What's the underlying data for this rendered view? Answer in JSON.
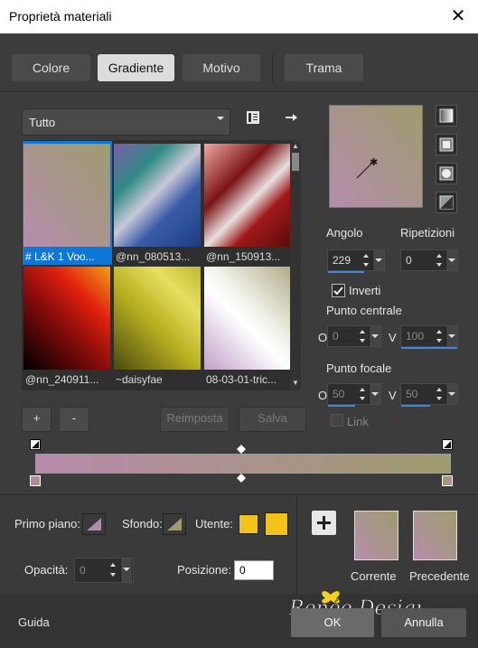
{
  "window": {
    "title": "Proprietà materiali",
    "close_symbol": "✕"
  },
  "tabs": [
    {
      "label": "Colore"
    },
    {
      "label": "Gradiente"
    },
    {
      "label": "Motivo"
    },
    {
      "label": "Trama"
    }
  ],
  "category": {
    "value": "Tutto"
  },
  "gradients": [
    {
      "label": "# L&K 1 Voo...",
      "selected": true
    },
    {
      "label": "@nn_080513...",
      "selected": false
    },
    {
      "label": "@nn_150913...",
      "selected": false
    },
    {
      "label": "@nn_240911...",
      "selected": false
    },
    {
      "label": "~daisyfae",
      "selected": false
    },
    {
      "label": "08-03-01-tric...",
      "selected": false
    }
  ],
  "buttons": {
    "add": "+",
    "remove": "-",
    "reset": "Reimposta",
    "save": "Salva"
  },
  "angle": {
    "label": "Angolo",
    "value": "229"
  },
  "repeats": {
    "label": "Ripetizioni",
    "value": "0"
  },
  "invert": {
    "label": "Inverti",
    "checked": true
  },
  "center_point": {
    "label": "Punto centrale",
    "o_label": "O",
    "o_value": "0",
    "v_label": "V",
    "v_value": "100"
  },
  "focal_point": {
    "label": "Punto focale",
    "o_label": "O",
    "o_value": "50",
    "v_label": "V",
    "v_value": "50"
  },
  "link": {
    "label": "Link",
    "checked": false
  },
  "materials": {
    "foreground_label": "Primo piano:",
    "background_label": "Sfondo:",
    "user_label": "Utente:"
  },
  "opacity": {
    "label": "Opacità:",
    "value": "0"
  },
  "position": {
    "label": "Posizione:",
    "value": "0"
  },
  "current": {
    "label": "Corrente"
  },
  "previous": {
    "label": "Precedente"
  },
  "footer": {
    "help": "Guida",
    "ok": "OK",
    "cancel": "Annulla"
  },
  "watermark": "Renée Design",
  "colors": {
    "accent": "#0f78d7",
    "user_swatch": "#f2c21b",
    "gradient_start": "#b78aab",
    "gradient_end": "#9e9b6e"
  }
}
